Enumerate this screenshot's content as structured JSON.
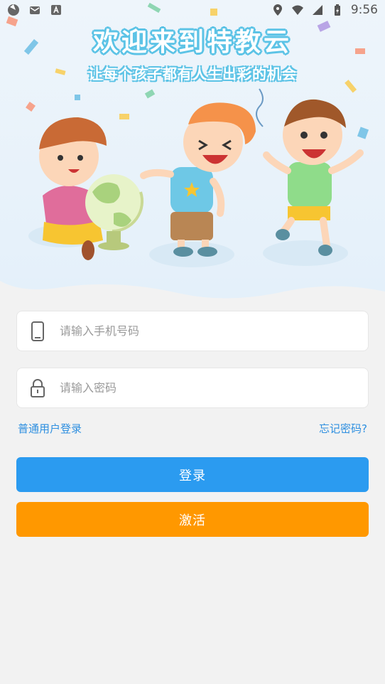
{
  "status_bar": {
    "time": "9:56"
  },
  "banner": {
    "title": "欢迎来到特教云",
    "subtitle": "让每个孩子都有人生出彩的机会"
  },
  "form": {
    "phone_placeholder": "请输入手机号码",
    "password_placeholder": "请输入密码",
    "normal_login_link": "普通用户登录",
    "forgot_password_link": "忘记密码?",
    "login_button": "登录",
    "activate_button": "激活"
  },
  "colors": {
    "primary": "#2b9bf0",
    "activate": "#ff9800",
    "link": "#2e8fe0"
  }
}
